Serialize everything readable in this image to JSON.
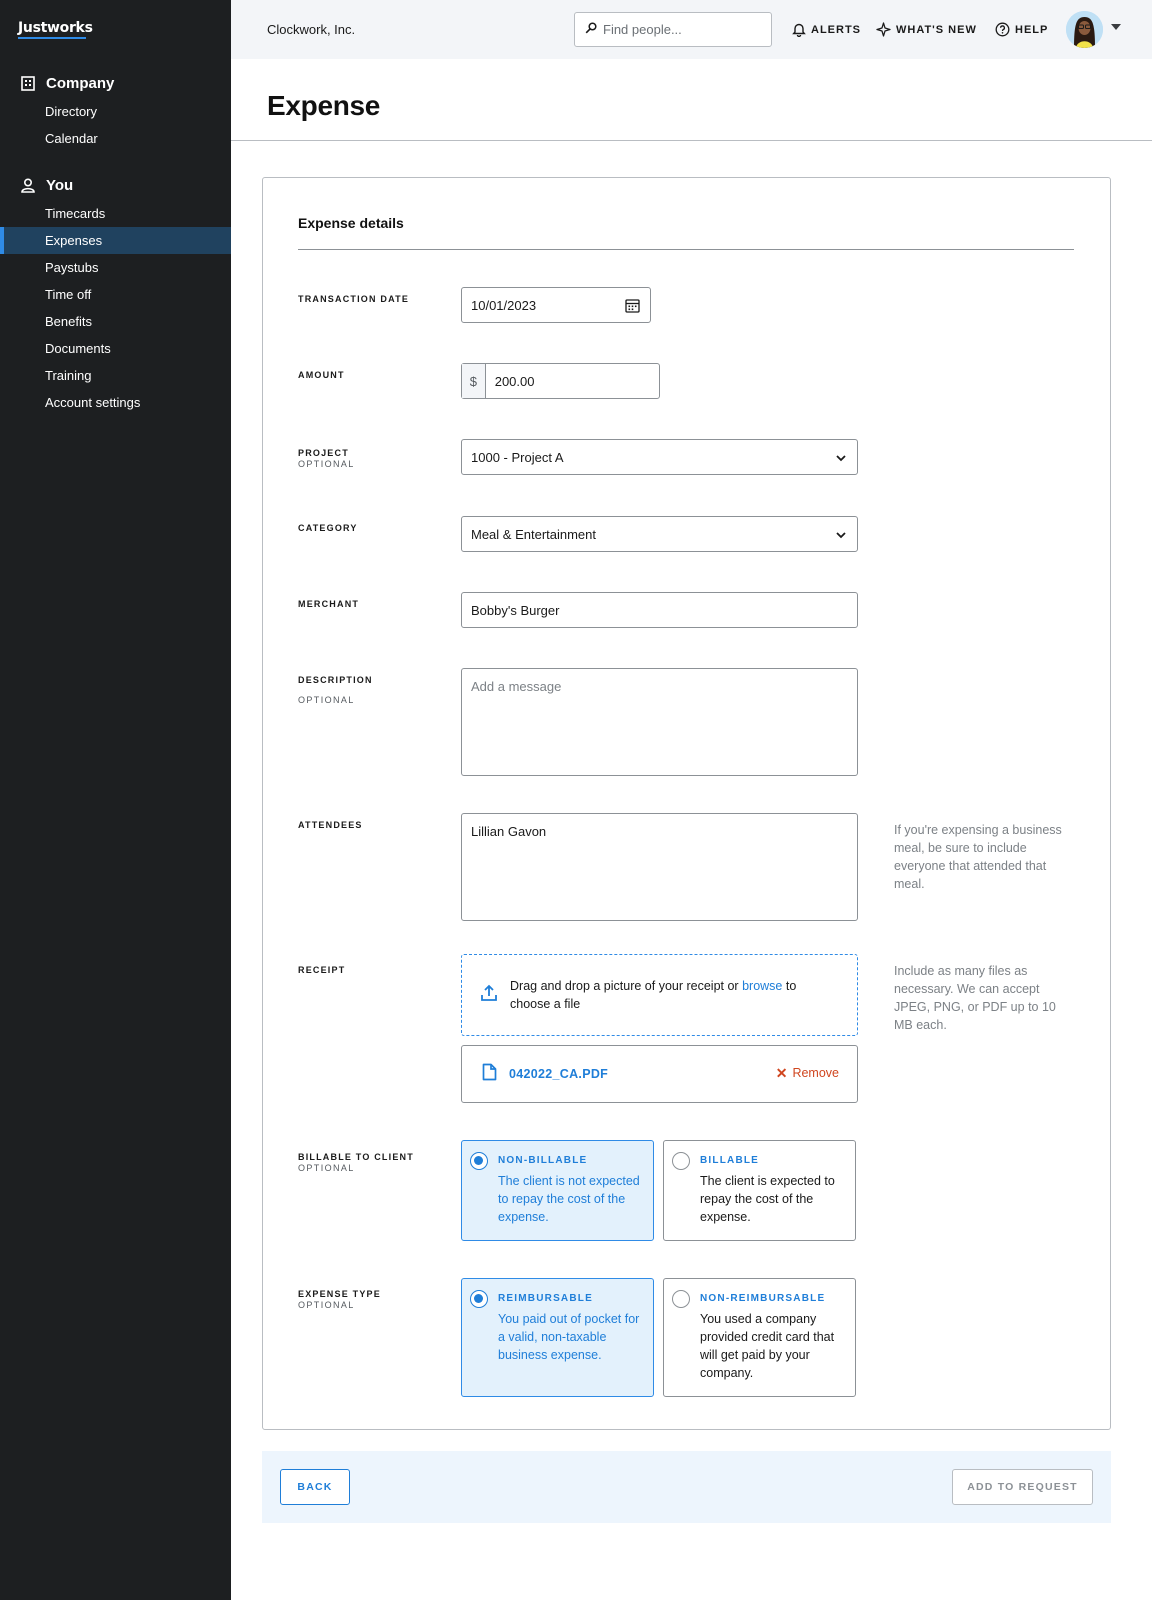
{
  "app": {
    "logo": "Justworks",
    "company": "Clockwork, Inc."
  },
  "sidebar": {
    "sections": [
      {
        "label": "Company",
        "icon": "building-icon",
        "items": [
          {
            "label": "Directory"
          },
          {
            "label": "Calendar"
          }
        ]
      },
      {
        "label": "You",
        "icon": "person-icon",
        "items": [
          {
            "label": "Timecards"
          },
          {
            "label": "Expenses",
            "active": true
          },
          {
            "label": "Paystubs"
          },
          {
            "label": "Time off"
          },
          {
            "label": "Benefits"
          },
          {
            "label": "Documents"
          },
          {
            "label": "Training"
          },
          {
            "label": "Account settings"
          }
        ]
      }
    ]
  },
  "header": {
    "search_placeholder": "Find people...",
    "alerts": "ALERTS",
    "whats_new": "WHAT'S NEW",
    "help": "HELP"
  },
  "page": {
    "title": "Expense"
  },
  "form": {
    "section_title": "Expense details",
    "optional": "OPTIONAL",
    "transaction_date": {
      "label": "TRANSACTION DATE",
      "value": "10/01/2023"
    },
    "amount": {
      "label": "AMOUNT",
      "prefix": "$",
      "value": "200.00"
    },
    "project": {
      "label": "PROJECT",
      "value": "1000 - Project A"
    },
    "category": {
      "label": "CATEGORY",
      "value": "Meal & Entertainment"
    },
    "merchant": {
      "label": "MERCHANT",
      "value": "Bobby's Burger"
    },
    "description": {
      "label": "DESCRIPTION",
      "placeholder": "Add a message",
      "value": ""
    },
    "attendees": {
      "label": "ATTENDEES",
      "value": "Lillian Gavon",
      "help": "If you're expensing a business meal, be sure to include everyone that attended that meal."
    },
    "receipt": {
      "label": "RECEIPT",
      "drop_text_before": "Drag and drop a picture of your receipt or",
      "drop_link": "browse",
      "drop_text_after": "to choose a file",
      "help": "Include as many files as necessary. We can accept JPEG, PNG, or PDF up to 10 MB each.",
      "file_name": "042022_CA.PDF",
      "remove": "Remove"
    },
    "billable": {
      "label": "BILLABLE TO CLIENT",
      "options": [
        {
          "title": "NON-BILLABLE",
          "desc": "The client is not expected to repay the cost of the expense.",
          "selected": true
        },
        {
          "title": "BILLABLE",
          "desc": "The client is expected to repay the cost of the expense.",
          "selected": false
        }
      ]
    },
    "expense_type": {
      "label": "EXPENSE TYPE",
      "options": [
        {
          "title": "REIMBURSABLE",
          "desc": "You paid out of pocket for a valid, non-taxable business expense.",
          "selected": true
        },
        {
          "title": "NON-REIMBURSABLE",
          "desc": "You used a company provided credit card that will get paid by your company.",
          "selected": false
        }
      ]
    }
  },
  "footer": {
    "back": "BACK",
    "add": "ADD TO REQUEST"
  },
  "colors": {
    "sidebar_bg": "#1d1f21",
    "accent": "#1f7ed8",
    "selected_bg": "#e3f1fc",
    "danger": "#d0461f"
  }
}
